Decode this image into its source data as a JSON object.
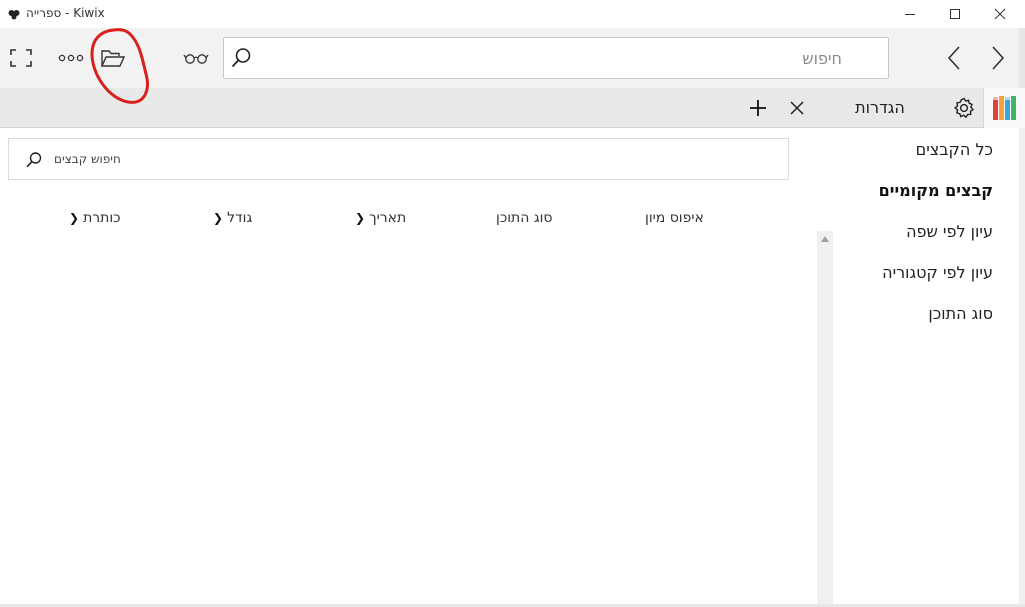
{
  "window": {
    "title": "ספרייה - Kiwix"
  },
  "toolbar": {
    "search_placeholder": "חיפוש",
    "icons": [
      "fullscreen-icon",
      "more-icon",
      "open-folder-icon",
      "reading-glasses-icon",
      "search-icon",
      "back-icon",
      "forward-icon"
    ]
  },
  "tabs": {
    "settings_label": "הגדרות",
    "icons": [
      "library-icon",
      "gear-icon",
      "close-icon",
      "add-tab-icon"
    ]
  },
  "library": {
    "search_placeholder": "חיפוש קבצים",
    "columns": {
      "reset_sort": "איפוס מיון",
      "content_type": "סוג התוכן",
      "date": "תאריך",
      "size": "גודל",
      "title": "כותרת"
    }
  },
  "nav": {
    "items": [
      {
        "label": "כל הקבצים",
        "selected": false
      },
      {
        "label": "קבצים מקומיים",
        "selected": true
      },
      {
        "label": "עיון לפי שפה",
        "selected": false
      },
      {
        "label": "עיון לפי קטגוריה",
        "selected": false
      },
      {
        "label": "סוג התוכן",
        "selected": false
      }
    ]
  },
  "colors": {
    "annotation": "#d9211c",
    "toolbar_bg": "#f2f2f2",
    "tabstrip_bg": "#e9e9e9"
  }
}
